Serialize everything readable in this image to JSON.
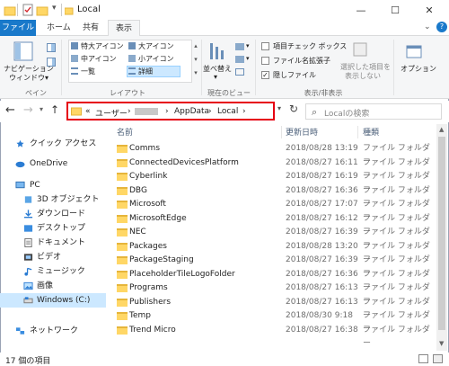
{
  "window": {
    "title": "Local",
    "controls": [
      "—",
      "☐",
      "✕"
    ]
  },
  "tabs": [
    "ファイル",
    "ホーム",
    "共有",
    "表示"
  ],
  "ribbon": {
    "pane": {
      "nav_pane_label1": "ナビゲーション",
      "nav_pane_label2": "ウィンドウ▾",
      "group": "ペイン"
    },
    "layout": {
      "items": [
        "特大アイコン",
        "大アイコン",
        "中アイコン",
        "小アイコン",
        "一覧",
        "詳細"
      ],
      "group": "レイアウト"
    },
    "current_view": {
      "sort_label1": "並べ替え",
      "sort_label2": "▾",
      "group": "現在のビュー"
    },
    "show_hide": {
      "item_checkbox": "項目チェック ボックス",
      "file_ext": "ファイル名拡張子",
      "hidden_items": "隠しファイル",
      "hide_selected1": "選択した項目を",
      "hide_selected2": "表示しない",
      "group": "表示/非表示"
    },
    "options": "オプション"
  },
  "address": {
    "prefix": "«",
    "segments": [
      "ユーザー",
      "AppData",
      "Local"
    ],
    "separator": "›"
  },
  "search": {
    "placeholder": "Localの検索"
  },
  "sidebar": [
    {
      "label": "クイック アクセス",
      "icon": "star-icon",
      "indent": 0
    },
    {
      "label": "OneDrive",
      "icon": "cloud-icon",
      "indent": 0
    },
    {
      "label": "PC",
      "icon": "pc-icon",
      "indent": 0
    },
    {
      "label": "3D オブジェクト",
      "icon": "cube-icon",
      "indent": 1
    },
    {
      "label": "ダウンロード",
      "icon": "download-icon",
      "indent": 1
    },
    {
      "label": "デスクトップ",
      "icon": "desktop-icon",
      "indent": 1
    },
    {
      "label": "ドキュメント",
      "icon": "document-icon",
      "indent": 1
    },
    {
      "label": "ビデオ",
      "icon": "video-icon",
      "indent": 1
    },
    {
      "label": "ミュージック",
      "icon": "music-icon",
      "indent": 1
    },
    {
      "label": "画像",
      "icon": "picture-icon",
      "indent": 1
    },
    {
      "label": "Windows (C:)",
      "icon": "drive-icon",
      "indent": 1,
      "selected": true
    },
    {
      "label": "ネットワーク",
      "icon": "network-icon",
      "indent": 0
    }
  ],
  "columns": {
    "name": "名前",
    "date": "更新日時",
    "type": "種類"
  },
  "files": [
    {
      "name": "Comms",
      "date": "2018/08/28 13:19",
      "type": "ファイル フォルダー"
    },
    {
      "name": "ConnectedDevicesPlatform",
      "date": "2018/08/27 16:11",
      "type": "ファイル フォルダー"
    },
    {
      "name": "Cyberlink",
      "date": "2018/08/27 16:19",
      "type": "ファイル フォルダー"
    },
    {
      "name": "DBG",
      "date": "2018/08/27 16:36",
      "type": "ファイル フォルダー"
    },
    {
      "name": "Microsoft",
      "date": "2018/08/27 17:07",
      "type": "ファイル フォルダー"
    },
    {
      "name": "MicrosoftEdge",
      "date": "2018/08/27 16:12",
      "type": "ファイル フォルダー"
    },
    {
      "name": "NEC",
      "date": "2018/08/27 16:39",
      "type": "ファイル フォルダー"
    },
    {
      "name": "Packages",
      "date": "2018/08/28 13:20",
      "type": "ファイル フォルダー"
    },
    {
      "name": "PackageStaging",
      "date": "2018/08/27 16:39",
      "type": "ファイル フォルダー"
    },
    {
      "name": "PlaceholderTileLogoFolder",
      "date": "2018/08/27 16:36",
      "type": "ファイル フォルダー"
    },
    {
      "name": "Programs",
      "date": "2018/08/27 16:13",
      "type": "ファイル フォルダー"
    },
    {
      "name": "Publishers",
      "date": "2018/08/27 16:13",
      "type": "ファイル フォルダー"
    },
    {
      "name": "Temp",
      "date": "2018/08/30 9:18",
      "type": "ファイル フォルダー"
    },
    {
      "name": "Trend Micro",
      "date": "2018/08/27 16:38",
      "type": "ファイル フォルダー"
    }
  ],
  "status": {
    "count": "17 個の項目"
  },
  "colors": {
    "accent": "#1979ca",
    "highlight": "#e60012",
    "selection": "#cce8ff",
    "folder": "#ffd766"
  }
}
